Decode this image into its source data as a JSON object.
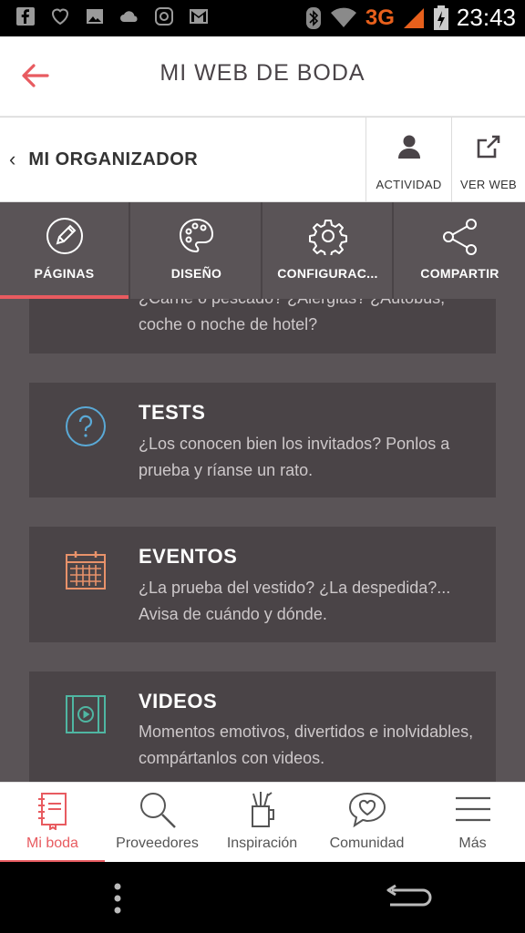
{
  "status_bar": {
    "network": "3G",
    "time": "23:43"
  },
  "header": {
    "title": "MI WEB DE BODA"
  },
  "organizer": {
    "label": "MI ORGANIZADOR",
    "activity_label": "ACTIVIDAD",
    "view_web_label": "VER WEB"
  },
  "tabs": [
    {
      "label": "PÁGINAS",
      "icon": "pencil-icon"
    },
    {
      "label": "DISEÑO",
      "icon": "palette-icon"
    },
    {
      "label": "CONFIGURAC...",
      "icon": "gear-icon"
    },
    {
      "label": "COMPARTIR",
      "icon": "share-icon"
    }
  ],
  "cards": [
    {
      "title": "",
      "text": "¿Carne o pescado? ¿Alergias? ¿Autobús, coche o noche de hotel?"
    },
    {
      "title": "TESTS",
      "text": "¿Los conocen bien los invitados? Ponlos a prueba y ríanse un rato.",
      "icon": "question-icon"
    },
    {
      "title": "EVENTOS",
      "text": "¿La prueba del vestido? ¿La despedida?... Avisa de cuándo y dónde.",
      "icon": "calendar-icon"
    },
    {
      "title": "VIDEOS",
      "text": "Momentos emotivos, divertidos e inolvidables, compártanlos con videos.",
      "icon": "video-icon"
    }
  ],
  "bottom_nav": [
    {
      "label": "Mi boda",
      "icon": "notebook-icon"
    },
    {
      "label": "Proveedores",
      "icon": "search-icon"
    },
    {
      "label": "Inspiración",
      "icon": "brush-cup-icon"
    },
    {
      "label": "Comunidad",
      "icon": "heart-bubble-icon"
    },
    {
      "label": "Más",
      "icon": "menu-icon"
    }
  ],
  "colors": {
    "accent": "#e85b60",
    "panel": "#5a5457",
    "card": "#4a4447",
    "tests_icon": "#5aa9d6",
    "eventos_icon": "#e8926a",
    "videos_icon": "#4fb6a2"
  }
}
